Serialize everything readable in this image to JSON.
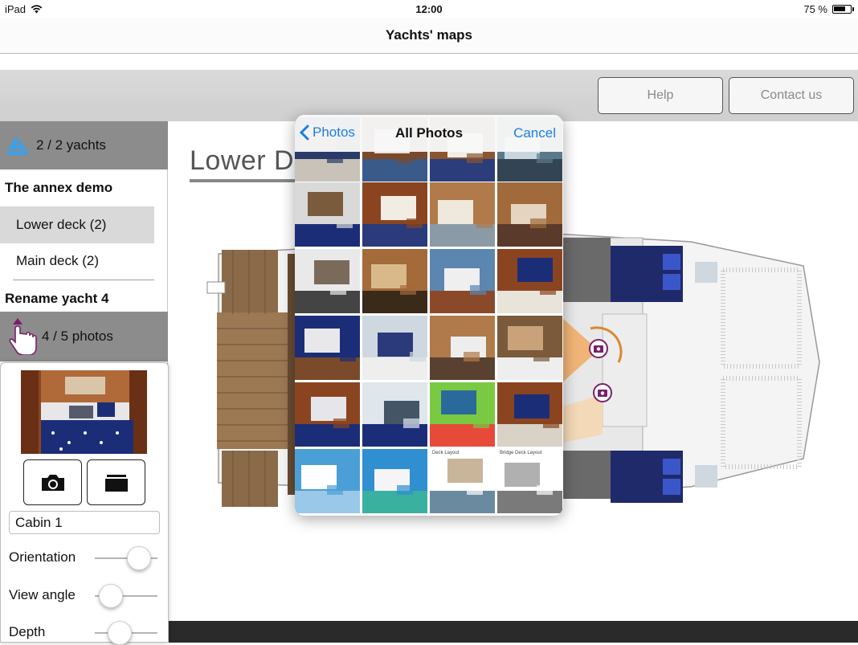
{
  "status_bar": {
    "device": "iPad",
    "time": "12:00",
    "battery": "75 %",
    "battery_level": 0.75
  },
  "nav": {
    "title": "Yachts' maps"
  },
  "toolbar": {
    "help_label": "Help",
    "contact_label": "Contact us"
  },
  "sidebar": {
    "yachts_counter": "2 / 2  yachts",
    "yacht_1": "The annex demo",
    "decks": [
      {
        "label": "Lower deck (2)",
        "selected": true
      },
      {
        "label": "Main deck (2)",
        "selected": false
      }
    ],
    "yacht_2": "Rename yacht 4",
    "photos_counter": "4 / 5  photos"
  },
  "photo_panel": {
    "photo_name": "Cabin 1",
    "sliders": [
      {
        "label": "Orientation",
        "value": 0.7
      },
      {
        "label": "View angle",
        "value": 0.25
      },
      {
        "label": "Depth",
        "value": 0.4
      }
    ]
  },
  "map": {
    "title": "Lower D"
  },
  "picker": {
    "back_label": "Photos",
    "title": "All Photos",
    "cancel_label": "Cancel",
    "thumb_labels": [
      "Deck Layout",
      "Bridge Deck Layout"
    ]
  },
  "colors": {
    "ios_blue": "#1a7ee6",
    "header_gray": "#8c8c8c",
    "accent_purple": "#7a1f6b",
    "fov_orange": "#f2a65a"
  }
}
